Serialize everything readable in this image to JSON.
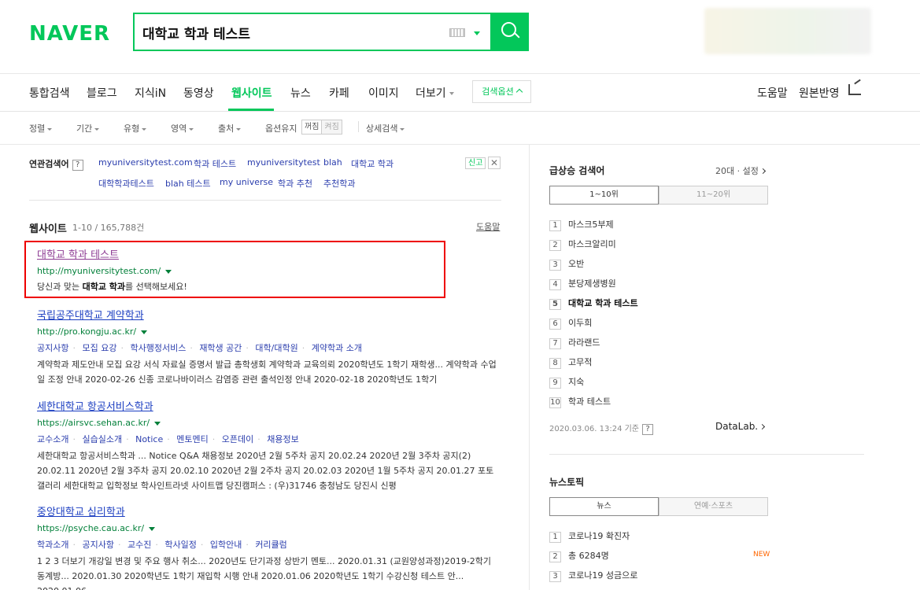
{
  "header": {
    "logo": "NAVER",
    "query": "대학교 학과 테스트"
  },
  "tabs": [
    {
      "label": "통합검색"
    },
    {
      "label": "블로그"
    },
    {
      "label": "지식iN"
    },
    {
      "label": "동영상"
    },
    {
      "label": "웹사이트"
    },
    {
      "label": "뉴스"
    },
    {
      "label": "카페"
    },
    {
      "label": "이미지"
    },
    {
      "label": "더보기"
    }
  ],
  "search_options_label": "검색옵션",
  "right_tabs": {
    "help": "도움말",
    "feedback": "원본반영"
  },
  "filters": {
    "sort": "정렬",
    "period": "기간",
    "type": "유형",
    "area": "영역",
    "source": "출처",
    "keep_option": "옵션유지",
    "off": "꺼짐",
    "on": "켜짐",
    "detail": "상세검색"
  },
  "related": {
    "label": "연관검색어",
    "help": "?",
    "items": [
      "myuniversitytest.com",
      "학과 테스트",
      "myuniversitytest",
      "blah",
      "대학교 학과",
      "대학학과테스트",
      "blah 테스트",
      "my universe",
      "학과 추천",
      "추천학과"
    ],
    "report": "신고",
    "close": "✕"
  },
  "section": {
    "title": "웹사이트",
    "count": "1-10 / 165,788건",
    "help": "도움말"
  },
  "results": [
    {
      "title": "대학교 학과 테스트",
      "url": "http://myuniversitytest.com/",
      "desc_pre": "당신과 맞는 ",
      "desc_bold": "대학교 학과",
      "desc_post": "를 선택해보세요!"
    },
    {
      "title": "국립공주대학교 계약학과",
      "url": "http://pro.kongju.ac.kr/",
      "links": [
        "공지사항",
        "모집 요강",
        "학사행정서비스",
        "재학생 공간",
        "대학/대학원",
        "계약학과 소개"
      ],
      "desc": "계약학과 제도안내 모집 요강 서식 자료실 증명서 발급 총학생회 계약학과 교육의뢰 2020학년도 1학기 재학생... 계약학과 수업 일 조정 안내 2020-02-26 신종 코로나바이러스 감염증 관련 출석인정 안내 2020-02-18 2020학년도 1학기"
    },
    {
      "title": "세한대학교 항공서비스학과",
      "url": "https://airsvc.sehan.ac.kr/",
      "links": [
        "교수소개",
        "실습실소개",
        "Notice",
        "멘토멘티",
        "오픈데이",
        "채용정보"
      ],
      "desc": "세한대학교 항공서비스학과 ... Notice Q&A 채용정보 2020년 2월 5주차 공지 20.02.24 2020년 2월 3주차 공지(2) 20.02.11 2020년 2월 3주차 공지 20.02.10 2020년 2월 2주차 공지 20.02.03 2020년 1월 5주차 공지 20.01.27 포토갤러리 세한대학교 입학정보 학사인트라넷 사이트맵 당진캠퍼스 : (우)31746 충청남도 당진시 신평"
    },
    {
      "title": "중앙대학교 심리학과",
      "url": "https://psyche.cau.ac.kr/",
      "links": [
        "학과소개",
        "공지사항",
        "교수진",
        "학사일정",
        "입학안내",
        "커리큘럼"
      ],
      "desc": "1 2 3 더보기 개강일 변경 및 주요 행사 취소... 2020년도 단기과정 상반기 멘토... 2020.01.31 (교원양성과정)2019-2학기 동계방... 2020.01.30 2020학년도 1학기 재입학 시행 안내 2020.01.06 2020학년도 1학기 수강신청 테스트 안... 2020.01.06"
    }
  ],
  "trending": {
    "title": "급상승 검색어",
    "age": "20대",
    "settings": "설정",
    "tabs": [
      "1~10위",
      "11~20위"
    ],
    "items": [
      {
        "rank": "1",
        "label": "마스크5부제"
      },
      {
        "rank": "2",
        "label": "마스크알리미"
      },
      {
        "rank": "3",
        "label": "오반"
      },
      {
        "rank": "4",
        "label": "분당제생병원"
      },
      {
        "rank": "5",
        "label": "대학교 학과 테스트"
      },
      {
        "rank": "6",
        "label": "이두희"
      },
      {
        "rank": "7",
        "label": "라라랜드"
      },
      {
        "rank": "8",
        "label": "고무적"
      },
      {
        "rank": "9",
        "label": "지숙"
      },
      {
        "rank": "10",
        "label": "학과 테스트"
      }
    ],
    "updated": "2020.03.06. 13:24 기준",
    "datalab": "DataLab."
  },
  "news_topic": {
    "title": "뉴스토픽",
    "tabs": [
      "뉴스",
      "연예·스포츠"
    ],
    "items": [
      {
        "rank": "1",
        "label": "코로나19 확진자"
      },
      {
        "rank": "2",
        "label": "총 6284명",
        "badge": "NEW"
      },
      {
        "rank": "3",
        "label": "코로나19 성금으로"
      }
    ]
  },
  "colors": {
    "brand": "#03c75a",
    "link": "#1a3dc1",
    "visited": "#8e3d94",
    "url": "#03803a",
    "highlight": "#ee0000"
  }
}
